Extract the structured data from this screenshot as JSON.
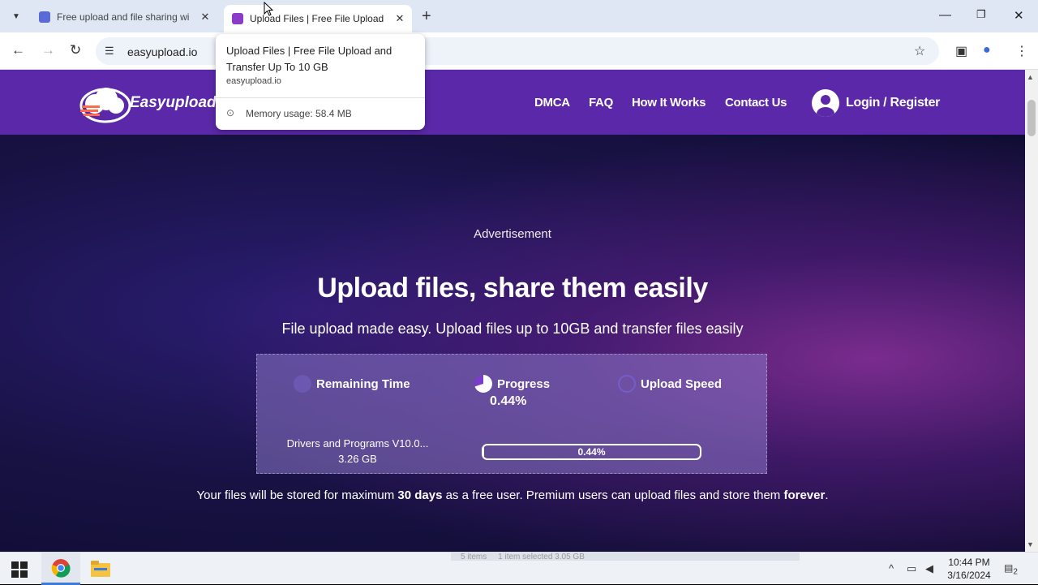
{
  "browser": {
    "tabs": [
      {
        "title": "Free upload and file sharing wi",
        "favicon_color": "#5a6bd8",
        "active": false
      },
      {
        "title": "Upload Files | Free File Upload",
        "favicon_color": "#8a3cc9",
        "active": true
      }
    ],
    "url": "easyupload.io",
    "tooltip": {
      "title": "Upload Files | Free File Upload and Transfer Up To 10 GB",
      "host": "easyupload.io",
      "memory": "Memory usage: 58.4 MB"
    }
  },
  "site": {
    "logo_text": "Easyupload.io",
    "nav": {
      "dmca": "DMCA",
      "faq": "FAQ",
      "how": "How It Works",
      "contact": "Contact Us",
      "login": "Login / Register"
    },
    "advertisement": "Advertisement",
    "headline": "Upload files, share them easily",
    "subheadline": "File upload made easy. Upload files up to 10GB and transfer files easily",
    "upload": {
      "remaining_label": "Remaining Time",
      "progress_label": "Progress",
      "speed_label": "Upload Speed",
      "progress_value": "0.44%",
      "progress_fraction": 0.0044,
      "file_name": "Drivers and Programs V10.0...",
      "file_size": "3.26 GB",
      "bar_label": "0.44%"
    },
    "note": {
      "part1": "Your files will be stored for maximum ",
      "days": "30 days",
      "part2": " as a free user. Premium users can upload files and store them ",
      "forever": "forever",
      "part3": "."
    }
  },
  "taskbar": {
    "ghost_items": "5 items",
    "ghost_selected": "1 item selected  3.05 GB",
    "time": "10:44 PM",
    "date": "3/16/2024",
    "notification_count": "2"
  },
  "colors": {
    "header": "#5a28a8",
    "accent": "#3d7bd6"
  }
}
